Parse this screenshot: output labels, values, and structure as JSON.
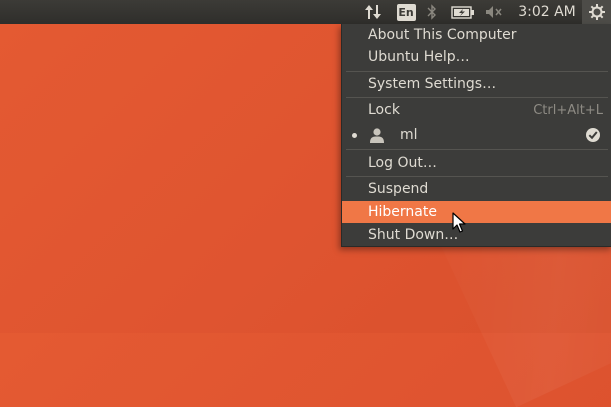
{
  "panel": {
    "keyboard_layout": "En",
    "clock": "3:02 AM",
    "indicators": [
      "network-updown-icon",
      "keyboard-layout-indicator",
      "bluetooth-icon",
      "battery-icon",
      "volume-muted-icon",
      "gear-icon"
    ]
  },
  "menu": {
    "items": [
      {
        "label": "About This Computer"
      },
      {
        "label": "Ubuntu Help…"
      },
      {
        "label": "System Settings…"
      },
      {
        "label": "Lock",
        "shortcut": "Ctrl+Alt+L"
      },
      {
        "label": "ml",
        "active": true,
        "checked": true
      },
      {
        "label": "Log Out…"
      },
      {
        "label": "Suspend"
      },
      {
        "label": "Hibernate",
        "highlighted": true
      },
      {
        "label": "Shut Down…"
      }
    ]
  },
  "colors": {
    "desktop": "#e0552f",
    "panel": "#3c3b37",
    "menu_bg": "#3c3c3a",
    "highlight": "#f07746"
  }
}
